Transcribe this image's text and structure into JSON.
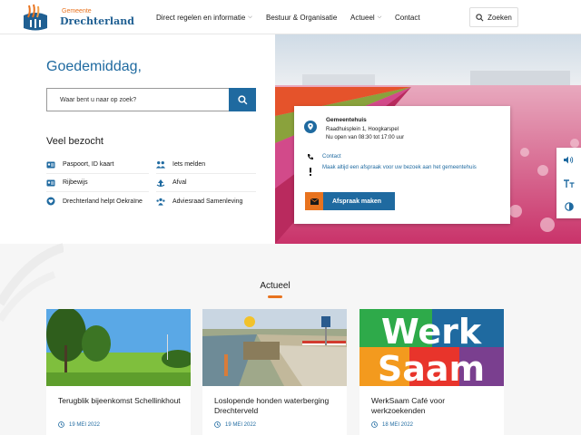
{
  "header": {
    "logo_small": "Gemeente",
    "logo_name": "Drechterland",
    "nav": [
      {
        "label": "Direct regelen en informatie",
        "has_dropdown": true
      },
      {
        "label": "Bestuur & Organisatie",
        "has_dropdown": false
      },
      {
        "label": "Actueel",
        "has_dropdown": true
      },
      {
        "label": "Contact",
        "has_dropdown": false
      }
    ],
    "search_label": "Zoeken"
  },
  "hero": {
    "greeting": "Goedemiddag,",
    "search_placeholder": "Waar bent u naar op zoek?",
    "popular_title": "Veel bezocht",
    "popular": [
      {
        "label": "Paspoort, ID kaart",
        "icon": "id-card-icon"
      },
      {
        "label": "Iets melden",
        "icon": "people-icon"
      },
      {
        "label": "Rijbewijs",
        "icon": "license-icon"
      },
      {
        "label": "Afval",
        "icon": "recycle-icon"
      },
      {
        "label": "Drechterland helpt Oekraïne",
        "icon": "heart-hands-icon"
      },
      {
        "label": "Adviesraad Samenleving",
        "icon": "group-icon"
      }
    ]
  },
  "contact_card": {
    "name": "Gemeentehuis",
    "address": "Raadhuisplein 1, Hoogkarspel",
    "hours": "Nu open van 08:30 tot 17:00 uur",
    "contact_label": "Contact",
    "appointment_text": "Maak altijd een afspraak voor uw bezoek aan het gemeentehuis",
    "appointment_button": "Afspraak maken"
  },
  "actueel": {
    "title": "Actueel",
    "items": [
      {
        "title": "Terugblik bijeenkomst Schellinkhout",
        "date": "19 MEI 2022"
      },
      {
        "title": "Loslopende honden waterberging Drechterveld",
        "date": "19 MEI 2022"
      },
      {
        "title": "WerkSaam Café voor werkzoekenden",
        "date": "18 MEI 2022"
      }
    ],
    "werksaam_line1": "Werk",
    "werksaam_line2": "Saam"
  },
  "colors": {
    "brand_blue": "#1f6aa0",
    "brand_orange": "#e8731f"
  }
}
